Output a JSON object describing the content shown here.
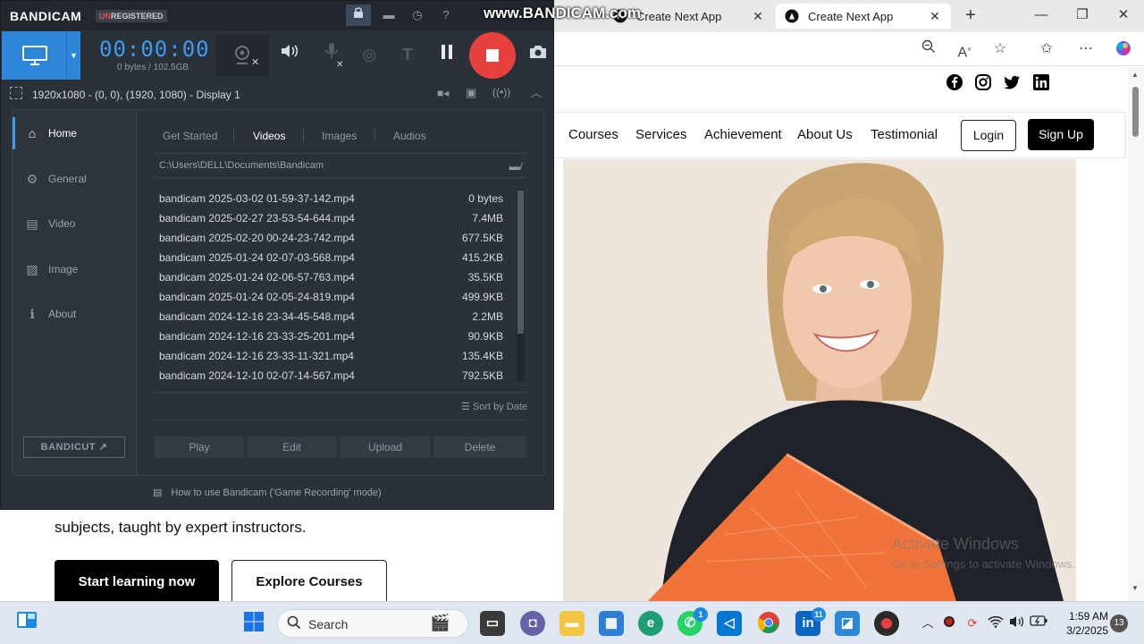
{
  "browser": {
    "tabs": [
      {
        "title": "Create Next App",
        "close": "✕"
      },
      {
        "title": "Create Next App",
        "close": "✕"
      }
    ],
    "new_tab": "+",
    "window_controls": {
      "minimize": "—",
      "restore": "❐",
      "close": "✕"
    }
  },
  "site": {
    "nav": {
      "links": [
        "Courses",
        "Services",
        "Achievement",
        "About Us",
        "Testimonial"
      ],
      "login": "Login",
      "signup": "Sign Up"
    },
    "hero": {
      "subtitle": "subjects, taught by expert instructors.",
      "cta_primary": "Start learning now",
      "cta_secondary": "Explore Courses"
    },
    "activation": {
      "title": "Activate Windows",
      "subtitle": "Go to Settings to activate Windows."
    }
  },
  "bandicam": {
    "logo": "BANDICAM",
    "unregistered_prefix": "UN",
    "unregistered_rest": "REGISTERED",
    "watermark": "www.BANDICAM.com",
    "timer": "00:00:00",
    "bytes": "0 bytes / 102.5GB",
    "target": "1920x1080 - (0, 0), (1920, 1080) - Display 1",
    "sidebar": [
      {
        "label": "Home",
        "icon": "home-icon"
      },
      {
        "label": "General",
        "icon": "gear-icon"
      },
      {
        "label": "Video",
        "icon": "video-icon"
      },
      {
        "label": "Image",
        "icon": "image-icon"
      },
      {
        "label": "About",
        "icon": "info-icon"
      }
    ],
    "bandicut": "BANDICUT ↗",
    "tabs": [
      "Get Started",
      "Videos",
      "Images",
      "Audios"
    ],
    "active_tab": "Videos",
    "path": "C:\\Users\\DELL\\Documents\\Bandicam",
    "files": [
      {
        "name": "bandicam 2025-03-02 01-59-37-142.mp4",
        "size": "0 bytes"
      },
      {
        "name": "bandicam 2025-02-27 23-53-54-644.mp4",
        "size": "7.4MB"
      },
      {
        "name": "bandicam 2025-02-20 00-24-23-742.mp4",
        "size": "677.5KB"
      },
      {
        "name": "bandicam 2025-01-24 02-07-03-568.mp4",
        "size": "415.2KB"
      },
      {
        "name": "bandicam 2025-01-24 02-06-57-763.mp4",
        "size": "35.5KB"
      },
      {
        "name": "bandicam 2025-01-24 02-05-24-819.mp4",
        "size": "499.9KB"
      },
      {
        "name": "bandicam 2024-12-16 23-34-45-548.mp4",
        "size": "2.2MB"
      },
      {
        "name": "bandicam 2024-12-16 23-33-25-201.mp4",
        "size": "90.9KB"
      },
      {
        "name": "bandicam 2024-12-16 23-33-11-321.mp4",
        "size": "135.4KB"
      },
      {
        "name": "bandicam 2024-12-10 02-07-14-567.mp4",
        "size": "792.5KB"
      }
    ],
    "sort_label": "Sort by Date",
    "actions": [
      "Play",
      "Edit",
      "Upload",
      "Delete"
    ],
    "footer_hint": "How to use Bandicam ('Game Recording' mode)"
  },
  "taskbar": {
    "search_placeholder": "Search",
    "time": "1:59 AM",
    "date": "3/2/2025",
    "notifications": "13",
    "linkedin_badge": "11",
    "whatsapp_badge": "1"
  },
  "colors": {
    "bandicam_bg": "#2b3139",
    "bandicam_accent": "#3b9cf0",
    "record_red": "#e8403f",
    "mode_blue": "#2d86d8"
  }
}
